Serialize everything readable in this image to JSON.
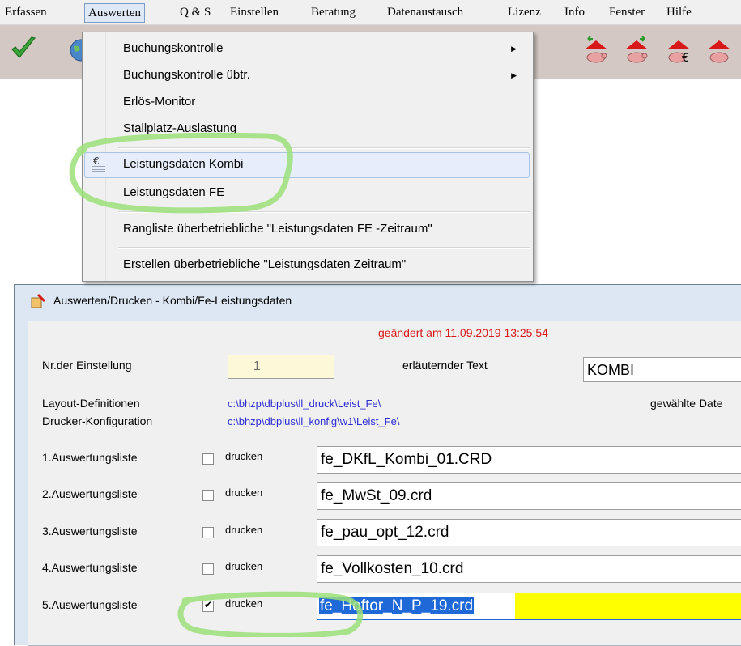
{
  "menubar": {
    "items": [
      "Erfassen",
      "Auswerten",
      "Q & S",
      "Einstellen",
      "Beratung",
      "Datenaustausch",
      "Lizenz",
      "Info",
      "Fenster",
      "Hilfe"
    ],
    "active": "Auswerten"
  },
  "toolbar": {
    "icons": [
      "checkmark-icon",
      "globe-icon",
      "pig-house-arrow-icon",
      "pig-house-arrow-icon",
      "pig-house-euro-icon",
      "pig-house-icon"
    ]
  },
  "menu": {
    "items": [
      {
        "label": "Buchungskontrolle",
        "submenu": true
      },
      {
        "label": "Buchungskontrolle übtr.",
        "submenu": true
      },
      {
        "label": "Erlös-Monitor",
        "submenu": false
      },
      {
        "label": "Stallplatz-Auslastung",
        "submenu": false
      },
      {
        "label": "Leistungsdaten Kombi",
        "submenu": false,
        "highlighted": true,
        "icon": "euro-list-icon"
      },
      {
        "label": "Leistungsdaten FE",
        "submenu": false
      },
      {
        "label": "Rangliste überbetriebliche \"Leistungsdaten FE  -Zeitraum\"",
        "submenu": false
      },
      {
        "label": "Erstellen überbetriebliche \"Leistungsdaten Zeitraum\"",
        "submenu": false
      }
    ]
  },
  "dialog": {
    "title": "Auswerten/Drucken - Kombi/Fe-Leistungsdaten",
    "changed": "geändert am 11.09.2019 13:25:54",
    "nr_label": "Nr.der Einstellung",
    "nr_value": "___1",
    "text_label": "erläuternder Text",
    "text_value": "KOMBI",
    "layout_label": "Layout-Definitionen",
    "layout_path": "c:\\bhzp\\dbplus\\ll_druck\\Leist_Fe\\",
    "printer_label": "Drucker-Konfiguration",
    "printer_path": "c:\\bhzp\\dbplus\\ll_konfig\\w1\\Leist_Fe\\",
    "chosen_label": "gewählte Date",
    "print_label": "drucken",
    "lists": [
      {
        "label": "1.Auswertungsliste",
        "checked": false,
        "file": "fe_DKfL_Kombi_01.CRD"
      },
      {
        "label": "2.Auswertungsliste",
        "checked": false,
        "file": "fe_MwSt_09.crd"
      },
      {
        "label": "3.Auswertungsliste",
        "checked": false,
        "file": "fe_pau_opt_12.crd"
      },
      {
        "label": "4.Auswertungsliste",
        "checked": false,
        "file": "fe_Vollkosten_10.crd"
      },
      {
        "label": "5.Auswertungsliste",
        "checked": true,
        "file": "fe_Hoftor_N_P_19.crd"
      }
    ]
  },
  "colors": {
    "toolbar_bg": "#d4c8c4",
    "highlight_green": "#9be07a",
    "selection_blue": "#1e68d8",
    "field_yellow": "#ffff00",
    "changed_red": "#d81818",
    "path_blue": "#2b2bd4"
  }
}
